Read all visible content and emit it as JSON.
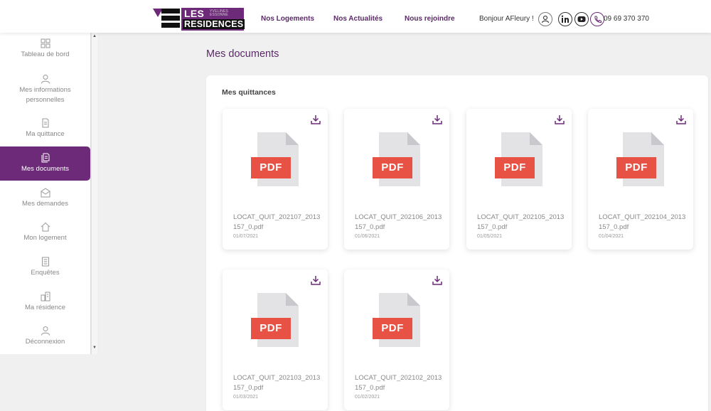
{
  "header": {
    "logo": {
      "line1": "LES",
      "line2": "RESIDENCES",
      "tagline": "YVELINES ESSONNE"
    },
    "nav": [
      "Nos Logements",
      "Nos Actualités",
      "Nous rejoindre"
    ],
    "greeting": "Bonjour AFleury !",
    "phone": "09 69 370 370"
  },
  "sidebar": {
    "items": [
      {
        "label": "Tableau de bord",
        "icon": "dashboard-icon"
      },
      {
        "label": "Mes informations personnelles",
        "icon": "user-icon"
      },
      {
        "label": "Ma quittance",
        "icon": "receipt-icon"
      },
      {
        "label": "Mes documents",
        "icon": "documents-icon",
        "active": true
      },
      {
        "label": "Mes demandes",
        "icon": "requests-icon"
      },
      {
        "label": "Mon logement",
        "icon": "home-icon"
      },
      {
        "label": "Enquêtes",
        "icon": "survey-icon"
      },
      {
        "label": "Ma résidence",
        "icon": "building-icon"
      },
      {
        "label": "Déconnexion",
        "icon": "logout-icon"
      }
    ]
  },
  "main": {
    "title": "Mes documents",
    "section_title": "Mes quittances",
    "pdf_badge": "PDF",
    "documents": [
      {
        "filename": "LOCAT_QUIT_202107_2013157_0.pdf",
        "date": "01/07/2021"
      },
      {
        "filename": "LOCAT_QUIT_202106_2013157_0.pdf",
        "date": "01/06/2021"
      },
      {
        "filename": "LOCAT_QUIT_202105_2013157_0.pdf",
        "date": "01/05/2021"
      },
      {
        "filename": "LOCAT_QUIT_202104_2013157_0.pdf",
        "date": "01/04/2021"
      },
      {
        "filename": "LOCAT_QUIT_202103_2013157_0.pdf",
        "date": "01/03/2021"
      },
      {
        "filename": "LOCAT_QUIT_202102_2013157_0.pdf",
        "date": "01/02/2021"
      }
    ]
  },
  "colors": {
    "brand_purple": "#6c2a78",
    "pdf_red": "#e85244",
    "page_bg": "#f0f0f0"
  }
}
